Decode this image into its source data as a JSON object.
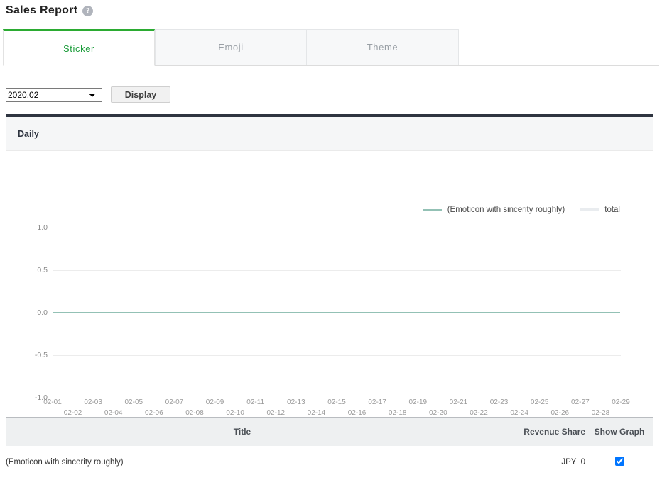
{
  "header": {
    "title": "Sales Report",
    "help_icon": "question-circle-icon",
    "help_label": "?"
  },
  "tabs": [
    {
      "label": "Sticker",
      "active": true
    },
    {
      "label": "Emoji",
      "active": false
    },
    {
      "label": "Theme",
      "active": false
    }
  ],
  "filter": {
    "period_value": "2020.02",
    "period_options": [
      "2020.02"
    ],
    "display_label": "Display"
  },
  "chart_panel": {
    "title": "Daily"
  },
  "table": {
    "columns": [
      "Title",
      "Revenue Share",
      "Show Graph"
    ],
    "rows": [
      {
        "title": "(Emoticon with sincerity roughly)",
        "revenue_share": "JPY  0",
        "show_graph": true
      }
    ]
  },
  "colors": {
    "series_primary": "#93c1b5",
    "series_total": "#e9ecef",
    "tab_active_accent": "#2bab32",
    "tab_active_text": "#1f9e3d",
    "panel_top_border": "#2e3440",
    "gridline": "#ececec"
  },
  "chart_data": {
    "type": "line",
    "title": "Daily",
    "xlabel": "",
    "ylabel": "",
    "ylim": [
      -1.0,
      1.0
    ],
    "yticks": [
      1.0,
      0.5,
      0.0,
      -0.5,
      -1.0
    ],
    "ytick_labels": [
      "1.0",
      "0.5",
      "0.0",
      "-0.5",
      "-1.0"
    ],
    "grid": true,
    "legend_position": "top-right",
    "categories": [
      "02-01",
      "02-02",
      "02-03",
      "02-04",
      "02-05",
      "02-06",
      "02-07",
      "02-08",
      "02-09",
      "02-10",
      "02-11",
      "02-12",
      "02-13",
      "02-14",
      "02-15",
      "02-16",
      "02-17",
      "02-18",
      "02-19",
      "02-20",
      "02-21",
      "02-22",
      "02-23",
      "02-24",
      "02-25",
      "02-26",
      "02-27",
      "02-28",
      "02-29"
    ],
    "series": [
      {
        "name": "(Emoticon with sincerity roughly)",
        "color": "#93c1b5",
        "values": [
          0,
          0,
          0,
          0,
          0,
          0,
          0,
          0,
          0,
          0,
          0,
          0,
          0,
          0,
          0,
          0,
          0,
          0,
          0,
          0,
          0,
          0,
          0,
          0,
          0,
          0,
          0,
          0,
          0
        ]
      },
      {
        "name": "total",
        "color": "#e9ecef",
        "values": [
          0,
          0,
          0,
          0,
          0,
          0,
          0,
          0,
          0,
          0,
          0,
          0,
          0,
          0,
          0,
          0,
          0,
          0,
          0,
          0,
          0,
          0,
          0,
          0,
          0,
          0,
          0,
          0,
          0
        ]
      }
    ]
  }
}
